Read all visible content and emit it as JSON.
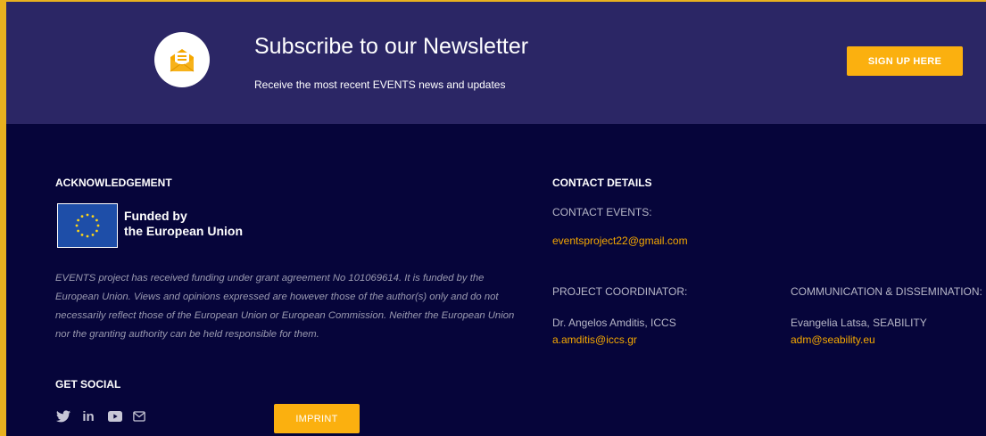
{
  "newsletter": {
    "title": "Subscribe to our Newsletter",
    "subtitle": "Receive the most recent EVENTS news and updates",
    "button_label": "SIGN UP HERE",
    "icon": "envelope-letter-icon"
  },
  "acknowledgement": {
    "heading": "ACKNOWLEDGEMENT",
    "eu_line1": "Funded by",
    "eu_line2": "the European Union",
    "disclaimer": "EVENTS project has received funding under grant agreement No 101069614. It is funded by the European Union. Views and opinions expressed are however those of the author(s) only and do not necessarily reflect those of the European Union or European Commission. Neither the European Union nor the granting authority can be held responsible for them."
  },
  "social": {
    "heading": "GET SOCIAL",
    "icons": [
      "twitter-icon",
      "linkedin-icon",
      "youtube-icon",
      "email-icon"
    ],
    "imprint_label": "IMPRINT"
  },
  "contact": {
    "heading": "CONTACT DETAILS",
    "events_label": "CONTACT EVENTS:",
    "events_email": "eventsproject22@gmail.com",
    "coordinator_label": "PROJECT COORDINATOR:",
    "coordinator_name": "Dr. Angelos Amditis, ICCS",
    "coordinator_email": "a.amditis@iccs.gr",
    "communication_label": "COMMUNICATION & DISSEMINATION:",
    "communication_name": "Evangelia Latsa, SEABILITY",
    "communication_email": "adm@seability.eu"
  },
  "colors": {
    "accent": "#fbb00f",
    "banner_bg": "#2b2665",
    "footer_bg": "#06053a",
    "border": "#e8b11f"
  }
}
